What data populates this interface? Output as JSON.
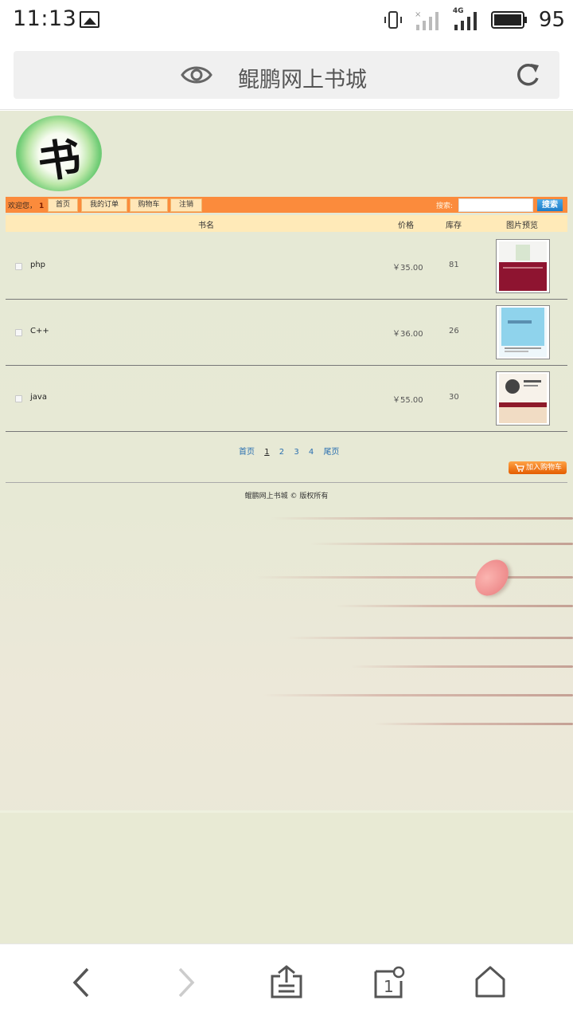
{
  "status_bar": {
    "time": "11:13",
    "network": "4G",
    "battery": "95"
  },
  "browser": {
    "title": "鲲鹏网上书城"
  },
  "site": {
    "logo_char": "书",
    "nav": {
      "welcome": "欢迎您，",
      "user": "1",
      "buttons": [
        "首页",
        "我的订单",
        "购物车",
        "注销"
      ],
      "search_label": "搜索:",
      "search_value": "",
      "search_button": "搜索"
    },
    "table": {
      "headers": {
        "name": "书名",
        "price": "价格",
        "stock": "库存",
        "preview": "图片预览"
      },
      "rows": [
        {
          "name": "php",
          "price": "￥35.00",
          "stock": "81"
        },
        {
          "name": "C++",
          "price": "￥36.00",
          "stock": "26"
        },
        {
          "name": "java",
          "price": "￥55.00",
          "stock": "30"
        }
      ]
    },
    "pager": {
      "first": "首页",
      "pages": [
        "1",
        "2",
        "3",
        "4"
      ],
      "current": "1",
      "last": "尾页"
    },
    "cart_button": "加入购物车",
    "copyright": "鲲鹏网上书城 © 版权所有"
  }
}
